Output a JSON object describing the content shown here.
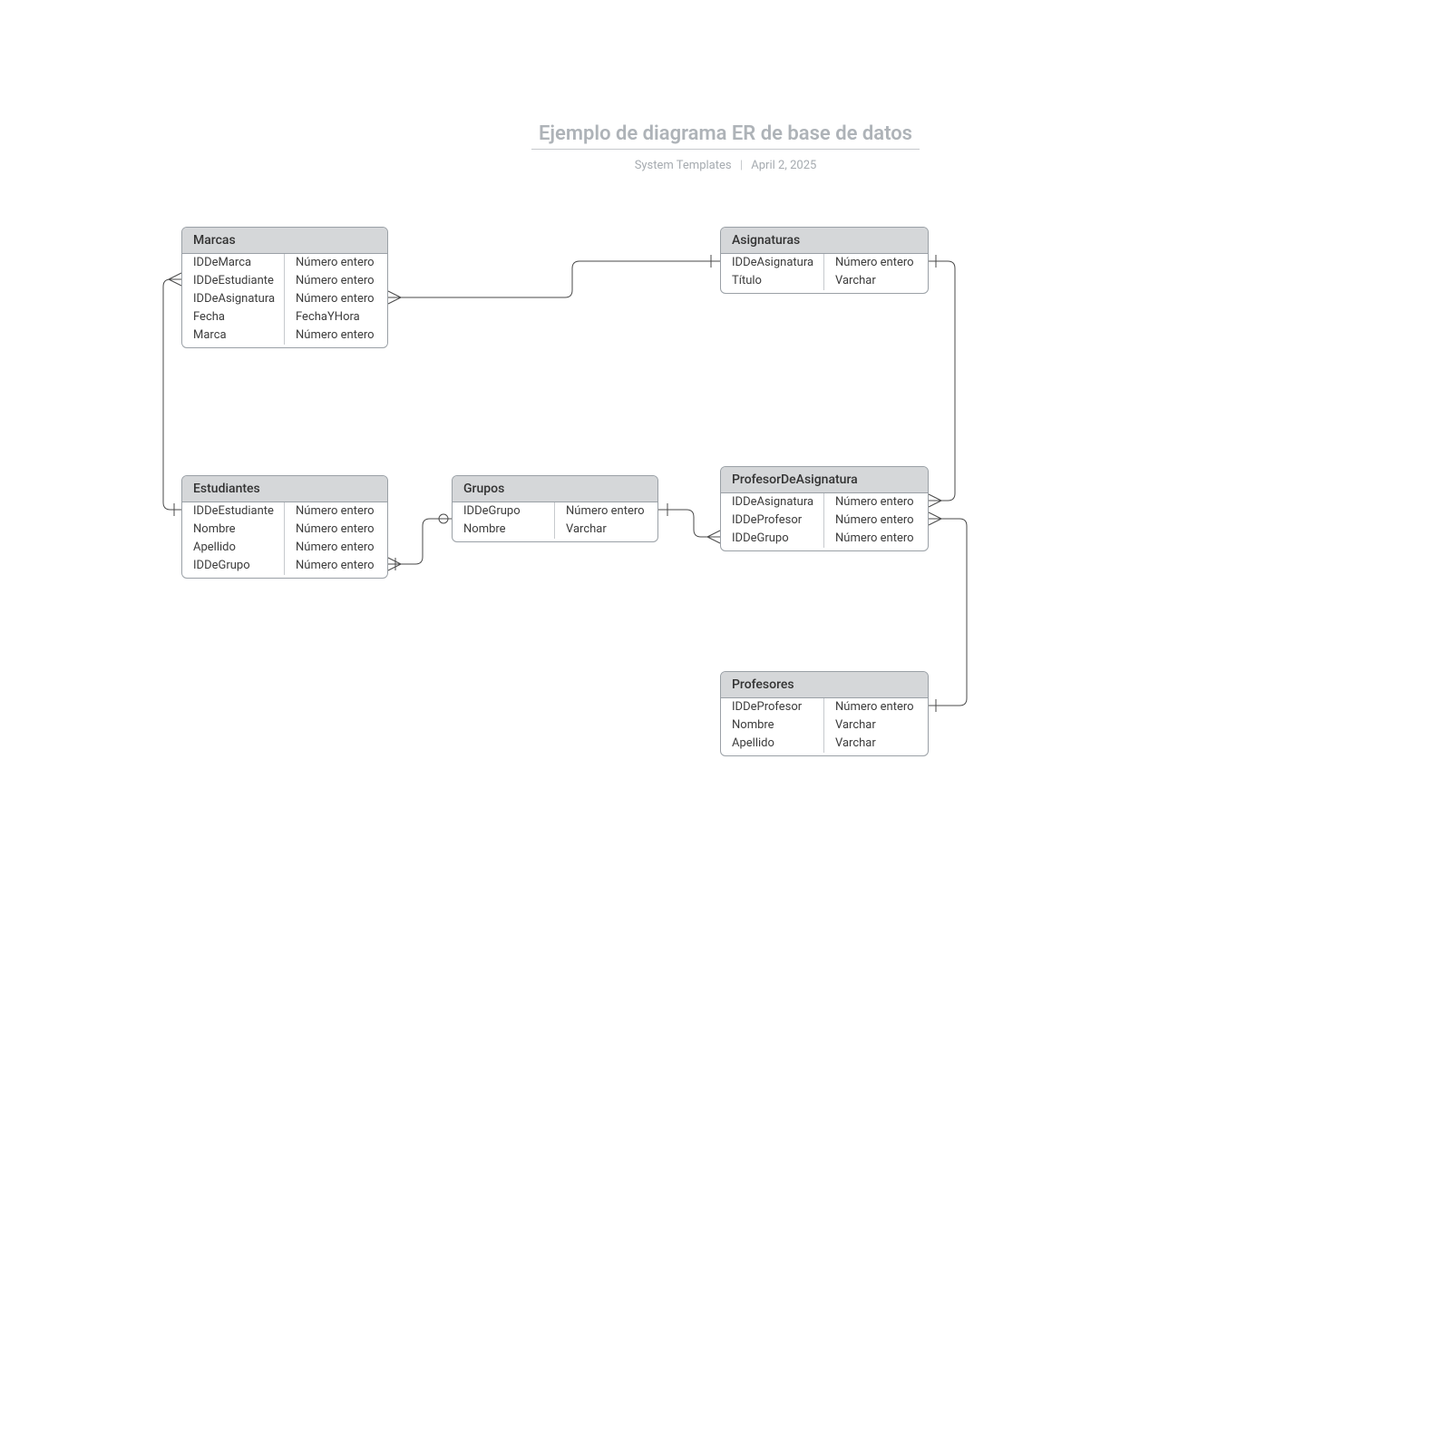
{
  "header": {
    "title": "Ejemplo de diagrama ER de base de datos",
    "author": "System Templates",
    "date": "April 2, 2025"
  },
  "entities": {
    "marcas": {
      "title": "Marcas",
      "rows": [
        {
          "name": "IDDeMarca",
          "type": "Número entero"
        },
        {
          "name": "IDDeEstudiante",
          "type": "Número entero"
        },
        {
          "name": "IDDeAsignatura",
          "type": "Número entero"
        },
        {
          "name": "Fecha",
          "type": "FechaYHora"
        },
        {
          "name": "Marca",
          "type": "Número entero"
        }
      ]
    },
    "asignaturas": {
      "title": "Asignaturas",
      "rows": [
        {
          "name": "IDDeAsignatura",
          "type": "Número entero"
        },
        {
          "name": "Título",
          "type": "Varchar"
        }
      ]
    },
    "estudiantes": {
      "title": "Estudiantes",
      "rows": [
        {
          "name": "IDDeEstudiante",
          "type": "Número entero"
        },
        {
          "name": "Nombre",
          "type": "Número entero"
        },
        {
          "name": "Apellido",
          "type": "Número entero"
        },
        {
          "name": "IDDeGrupo",
          "type": "Número entero"
        }
      ]
    },
    "grupos": {
      "title": "Grupos",
      "rows": [
        {
          "name": "IDDeGrupo",
          "type": "Número entero"
        },
        {
          "name": "Nombre",
          "type": "Varchar"
        }
      ]
    },
    "profasig": {
      "title": "ProfesorDeAsignatura",
      "rows": [
        {
          "name": "IDDeAsignatura",
          "type": "Número entero"
        },
        {
          "name": "IDDeProfesor",
          "type": "Número entero"
        },
        {
          "name": "IDDeGrupo",
          "type": "Número entero"
        }
      ]
    },
    "profesores": {
      "title": "Profesores",
      "rows": [
        {
          "name": "IDDeProfesor",
          "type": "Número entero"
        },
        {
          "name": "Nombre",
          "type": "Varchar"
        },
        {
          "name": "Apellido",
          "type": "Varchar"
        }
      ]
    }
  }
}
